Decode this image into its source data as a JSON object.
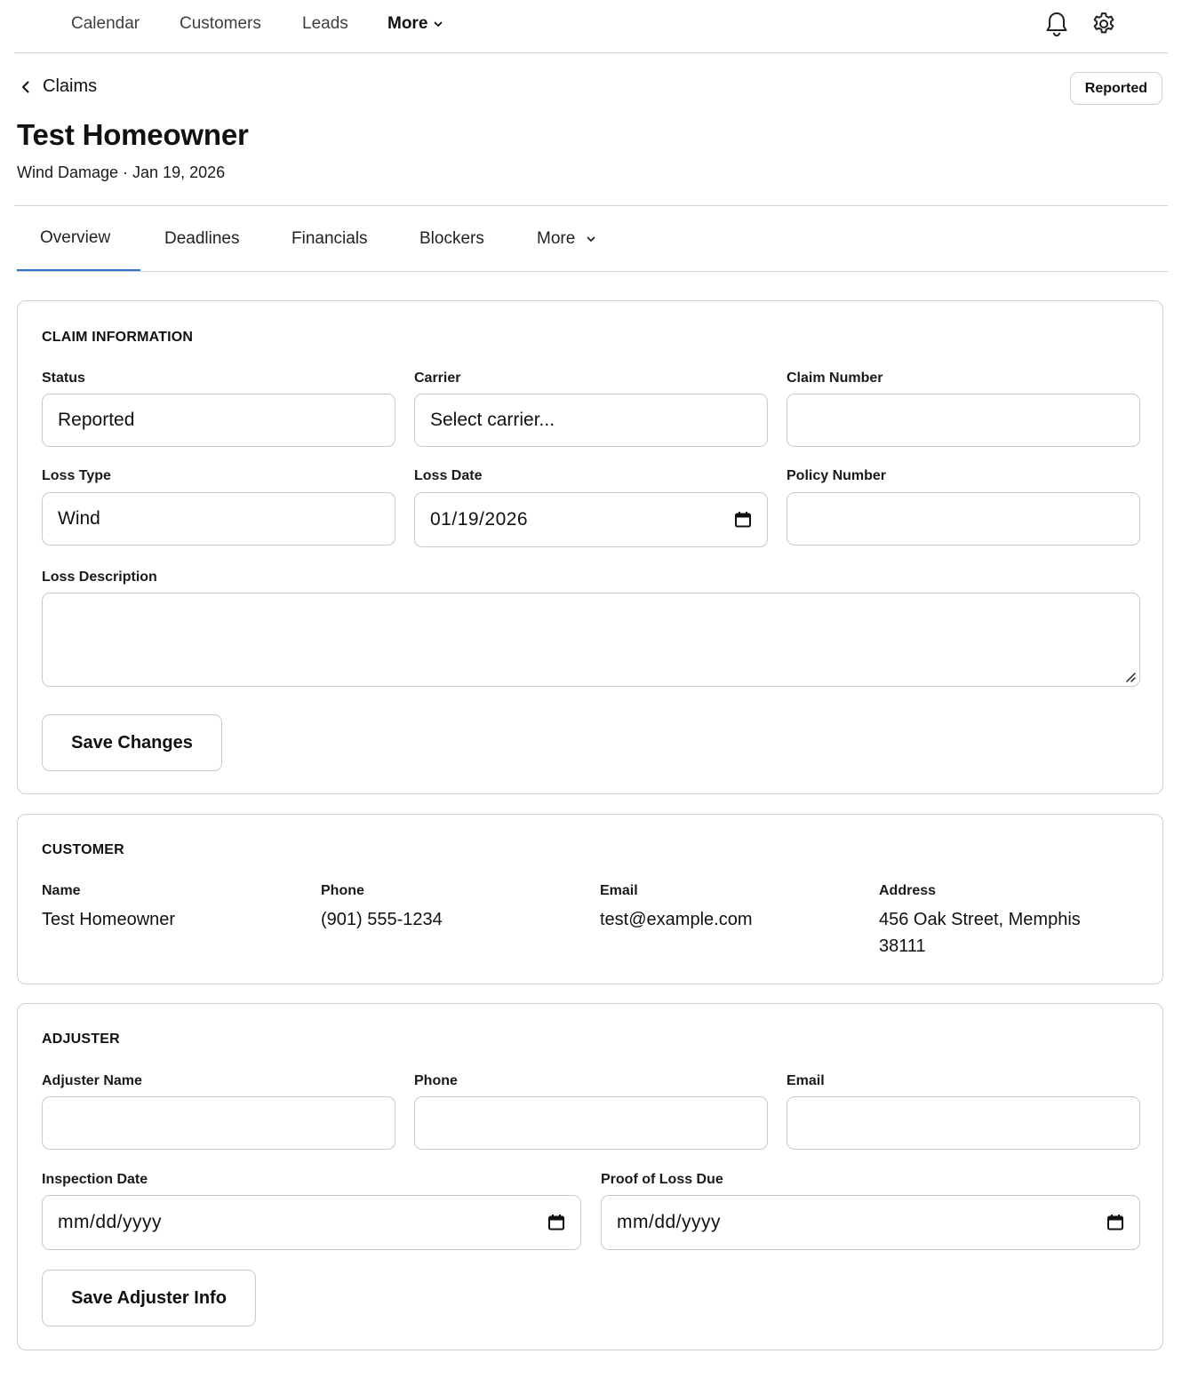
{
  "nav": {
    "calendar": "Calendar",
    "customers": "Customers",
    "leads": "Leads",
    "more": "More",
    "icons": {
      "notifications": "bell-icon",
      "settings": "gear-icon"
    }
  },
  "header": {
    "back_label": "Claims",
    "status_badge": "Reported",
    "title": "Test Homeowner",
    "subtitle": "Wind Damage · Jan 19, 2026"
  },
  "tabs": [
    {
      "label": "Overview",
      "active": true
    },
    {
      "label": "Deadlines"
    },
    {
      "label": "Financials"
    },
    {
      "label": "Blockers"
    },
    {
      "label": "More"
    }
  ],
  "claim_info": {
    "title": "CLAIM INFORMATION",
    "status": {
      "label": "Status",
      "value": "Reported"
    },
    "carrier": {
      "label": "Carrier",
      "value": "Select carrier..."
    },
    "claim_number": {
      "label": "Claim Number",
      "value": ""
    },
    "loss_type": {
      "label": "Loss Type",
      "value": "Wind"
    },
    "loss_date": {
      "label": "Loss Date",
      "value": "01/19/2026"
    },
    "policy_number": {
      "label": "Policy Number",
      "value": ""
    },
    "loss_description": {
      "label": "Loss Description",
      "value": ""
    },
    "save_label": "Save Changes"
  },
  "customer": {
    "title": "CUSTOMER",
    "name": {
      "label": "Name",
      "value": "Test Homeowner"
    },
    "phone": {
      "label": "Phone",
      "value": "(901) 555-1234"
    },
    "email": {
      "label": "Email",
      "value": "test@example.com"
    },
    "address": {
      "label": "Address",
      "line1": "456 Oak Street, Memphis",
      "line2": "38111"
    }
  },
  "adjuster": {
    "title": "ADJUSTER",
    "name": {
      "label": "Adjuster Name",
      "value": ""
    },
    "phone": {
      "label": "Phone",
      "value": ""
    },
    "email": {
      "label": "Email",
      "value": ""
    },
    "inspection_date": {
      "label": "Inspection Date",
      "placeholder": "mm/dd/yyyy"
    },
    "proof_of_loss_due": {
      "label": "Proof of Loss Due",
      "placeholder": "mm/dd/yyyy"
    },
    "save_label": "Save Adjuster Info"
  },
  "colors": {
    "accent": "#2f6fcf",
    "border": "#cfcfcf"
  }
}
